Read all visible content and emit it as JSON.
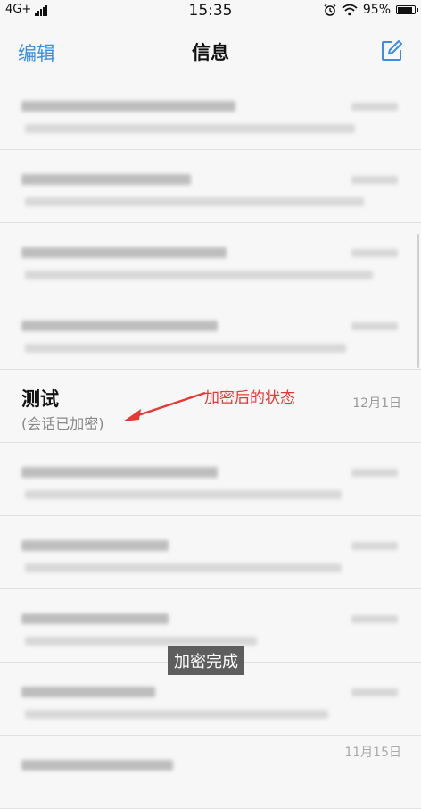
{
  "status_bar": {
    "network": "4G+",
    "time": "15:35",
    "battery": "95%",
    "battery_level": 0.95,
    "icons": [
      "signal-icon",
      "alarm-icon",
      "wifi-icon",
      "battery-icon"
    ]
  },
  "nav": {
    "edit_label": "编辑",
    "title": "信息",
    "compose_icon": "compose-icon"
  },
  "colors": {
    "accent": "#3a8ee6",
    "annotation": "#e53935",
    "toast_bg": "#505050"
  },
  "conversations": [
    {
      "blurred": true
    },
    {
      "blurred": true
    },
    {
      "blurred": true
    },
    {
      "blurred": true
    },
    {
      "blurred": false,
      "title": "测试",
      "subtitle": "(会话已加密)",
      "date": "12月1日"
    },
    {
      "blurred": true
    },
    {
      "blurred": true
    },
    {
      "blurred": true
    },
    {
      "blurred": true
    },
    {
      "blurred": true,
      "date": "11月15日"
    }
  ],
  "annotation": {
    "text": "加密后的状态"
  },
  "toast": {
    "text": "加密完成"
  }
}
